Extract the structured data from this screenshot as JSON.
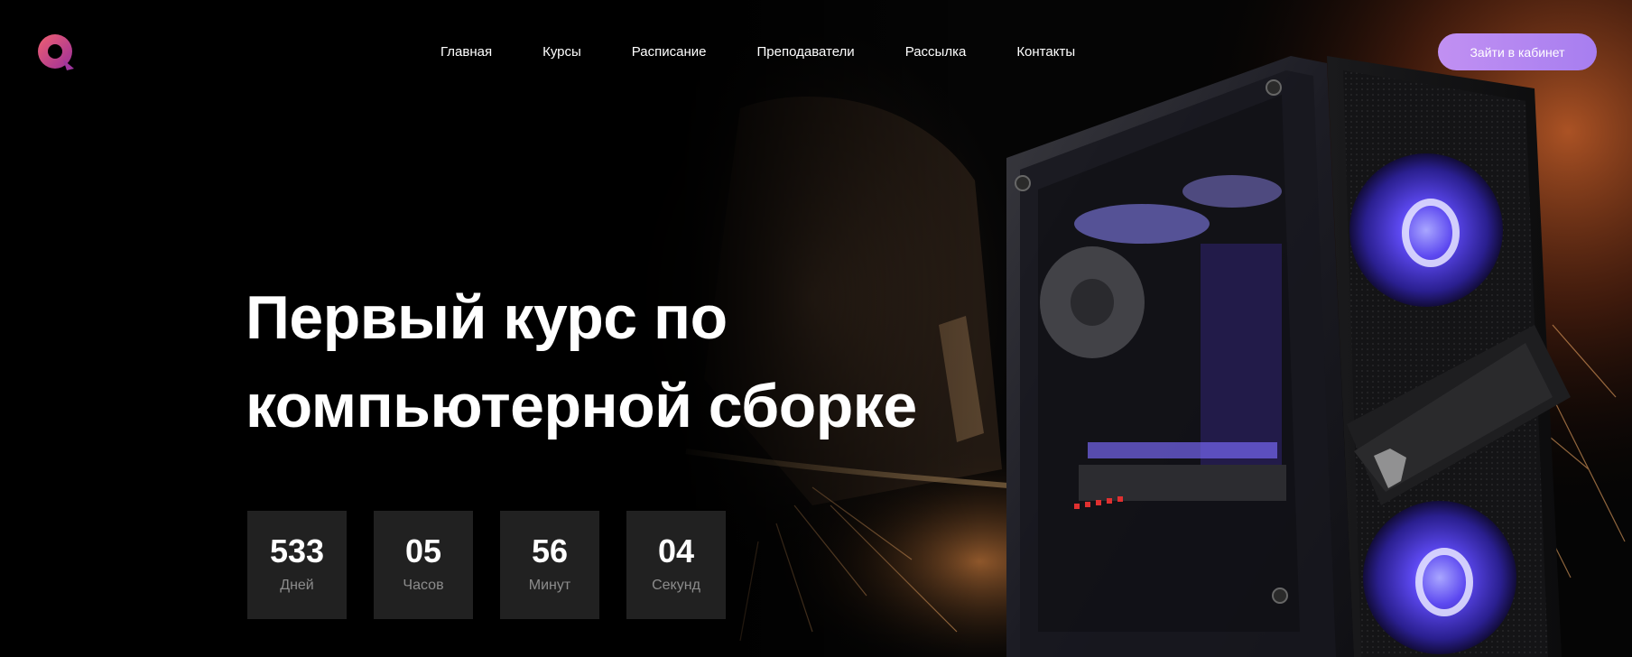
{
  "brand": {
    "logo_icon": "q-logo-icon",
    "accent_gradient": [
      "#f0507a",
      "#a33aa8"
    ]
  },
  "nav": {
    "items": [
      {
        "label": "Главная"
      },
      {
        "label": "Курсы"
      },
      {
        "label": "Расписание"
      },
      {
        "label": "Преподаватели"
      },
      {
        "label": "Рассылка"
      },
      {
        "label": "Контакты"
      }
    ]
  },
  "header": {
    "cabinet_button": "Зайти в кабинет",
    "cabinet_button_color": "#b68af1"
  },
  "hero": {
    "title_line1": "Первый курс по",
    "title_line2": "компьютерной сборке",
    "image_icon": "gaming-pc-case-illustration"
  },
  "countdown": [
    {
      "value": "533",
      "label": "Дней"
    },
    {
      "value": "05",
      "label": "Часов"
    },
    {
      "value": "56",
      "label": "Минут"
    },
    {
      "value": "04",
      "label": "Секунд"
    }
  ]
}
